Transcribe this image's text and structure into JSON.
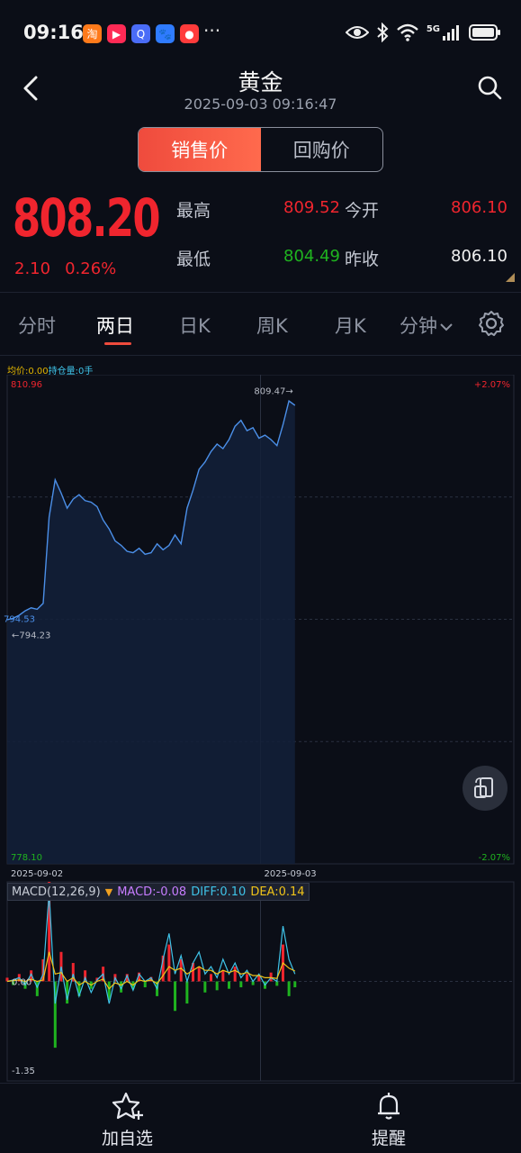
{
  "status_bar": {
    "time": "09:16",
    "more": "···",
    "network": "5G",
    "app_icons": [
      {
        "name": "taobao-app-icon",
        "color": "#ff7a1a",
        "glyph": "淘"
      },
      {
        "name": "video-app-icon",
        "color": "#ff2a55",
        "glyph": "▶"
      },
      {
        "name": "browser-app-icon",
        "color": "#4a6cf7",
        "glyph": "Q"
      },
      {
        "name": "baidu-app-icon",
        "color": "#2f7bff",
        "glyph": "🐾"
      },
      {
        "name": "map-app-icon",
        "color": "#ff3b3b",
        "glyph": "●"
      }
    ]
  },
  "header": {
    "title": "黄金",
    "timestamp": "2025-09-03 09:16:47"
  },
  "segment": {
    "tabs": [
      "销售价",
      "回购价"
    ],
    "active": 0
  },
  "quote": {
    "price": "808.20",
    "change": "2.10",
    "change_pct": "0.26%",
    "high_label": "最高",
    "high": "809.52",
    "open_label": "今开",
    "open": "806.10",
    "low_label": "最低",
    "low": "804.49",
    "prev_close_label": "昨收",
    "prev_close": "806.10"
  },
  "period_tabs": {
    "items": [
      "分时",
      "两日",
      "日K",
      "周K",
      "月K",
      "分钟"
    ],
    "active": 1
  },
  "chart_legend": {
    "avg": "均价:0.00",
    "hold": "持仓量:0手"
  },
  "colors": {
    "up": "#f0252e",
    "down": "#1fb31f",
    "line": "#4b8fe8",
    "avg": "#e0b400",
    "diff": "#3fc3e8",
    "dea": "#f0c419",
    "macd": "#c77dff"
  },
  "chart_data": [
    {
      "type": "line",
      "title": "",
      "xlabel": "",
      "ylabel": "",
      "ylim": [
        778.1,
        810.96
      ],
      "y_top_label": "810.96",
      "y_bottom_label": "778.10",
      "pct_top_label": "+2.07%",
      "pct_bottom_label": "-2.07%",
      "x_labels": [
        "2025-09-02",
        "2025-09-03"
      ],
      "marker_low": "←794.23",
      "marker_high": "809.47→",
      "start_label": "794.53",
      "grid": true,
      "day_split_fraction": 0.5,
      "series": [
        {
          "values": [
            794.5,
            794.6,
            794.8,
            795.1,
            795.3,
            795.2,
            795.6,
            801.4,
            803.9,
            803.0,
            802.0,
            802.6,
            802.9,
            802.5,
            802.4,
            802.1,
            801.2,
            800.6,
            799.8,
            799.5,
            799.1,
            799.0,
            799.3,
            798.9,
            799.0,
            799.6,
            799.2,
            799.5,
            800.2,
            799.6,
            802.0,
            803.2,
            804.6,
            805.1,
            805.8,
            806.3,
            806.0,
            806.6,
            807.5,
            807.9,
            807.2,
            807.4,
            806.7,
            806.9,
            806.6,
            806.2,
            807.6,
            809.2,
            808.9
          ]
        }
      ]
    },
    {
      "type": "bar",
      "title": "",
      "legend": "MACD(12,26,9)",
      "macd_label": "MACD:-0.08",
      "diff_label": "DIFF:0.10",
      "dea_label": "DEA:0.14",
      "ylim": [
        -1.35,
        1.35
      ],
      "y_bottom_label": "-1.35",
      "zero_label": "0.00",
      "macd": [
        0.05,
        -0.05,
        0.1,
        -0.1,
        0.15,
        -0.2,
        0.3,
        1.35,
        -0.9,
        0.4,
        -0.3,
        0.25,
        -0.2,
        0.15,
        -0.1,
        0.05,
        0.2,
        -0.25,
        0.1,
        -0.15,
        0.1,
        -0.1,
        0.12,
        -0.08,
        0.06,
        -0.2,
        0.35,
        0.5,
        -0.4,
        0.3,
        -0.3,
        0.25,
        0.2,
        -0.15,
        0.1,
        -0.12,
        0.15,
        -0.1,
        0.2,
        -0.08,
        0.1,
        -0.05,
        0.08,
        -0.1,
        0.12,
        -0.06,
        0.5,
        -0.2,
        -0.08
      ],
      "diff": [
        0.0,
        0.02,
        0.05,
        -0.05,
        0.1,
        -0.08,
        0.1,
        1.2,
        -0.3,
        0.2,
        -0.25,
        0.1,
        -0.2,
        0.05,
        -0.15,
        0.02,
        0.1,
        -0.3,
        0.05,
        -0.1,
        0.08,
        -0.12,
        0.1,
        0.0,
        0.05,
        -0.1,
        0.3,
        0.65,
        0.1,
        0.35,
        0.0,
        0.25,
        0.4,
        0.1,
        0.2,
        0.05,
        0.3,
        0.1,
        0.25,
        0.05,
        0.15,
        0.0,
        0.1,
        -0.05,
        0.05,
        0.0,
        0.75,
        0.3,
        0.1
      ],
      "dea": [
        0.0,
        0.01,
        0.02,
        0.0,
        0.03,
        0.0,
        0.02,
        0.4,
        0.1,
        0.12,
        0.0,
        0.05,
        -0.05,
        0.0,
        -0.05,
        0.0,
        0.03,
        -0.1,
        -0.02,
        -0.05,
        0.0,
        -0.05,
        0.02,
        0.0,
        0.02,
        -0.03,
        0.08,
        0.2,
        0.15,
        0.18,
        0.1,
        0.15,
        0.2,
        0.15,
        0.15,
        0.1,
        0.15,
        0.12,
        0.15,
        0.1,
        0.12,
        0.08,
        0.08,
        0.05,
        0.05,
        0.04,
        0.25,
        0.18,
        0.14
      ]
    }
  ],
  "bottom_bar": {
    "watchlist": "加自选",
    "alert": "提醒"
  }
}
